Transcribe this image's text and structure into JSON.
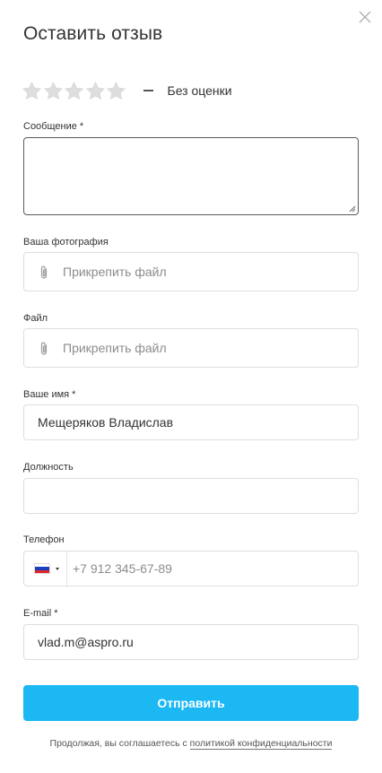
{
  "modal": {
    "title": "Оставить отзыв",
    "close_icon": "close-icon"
  },
  "rating": {
    "stars": 5,
    "selected": 0,
    "dash": "—",
    "text": "Без оценки",
    "star_color": "#dcdcdc"
  },
  "fields": {
    "message": {
      "label": "Сообщение *",
      "value": ""
    },
    "photo": {
      "label": "Ваша фотография",
      "placeholder": "Прикрепить файл",
      "icon": "paperclip-icon"
    },
    "file": {
      "label": "Файл",
      "placeholder": "Прикрепить файл",
      "icon": "paperclip-icon"
    },
    "name": {
      "label": "Ваше имя *",
      "value": "Мещеряков Владислав"
    },
    "position": {
      "label": "Должность",
      "value": ""
    },
    "phone": {
      "label": "Телефон",
      "placeholder": "+7 912 345-67-89",
      "country_flag": "russia-flag-icon"
    },
    "email": {
      "label": "E-mail *",
      "value": "vlad.m@aspro.ru"
    }
  },
  "submit": {
    "label": "Отправить",
    "color": "#1cb8f4"
  },
  "consent": {
    "text": "Продолжая, вы соглашаетесь с ",
    "link": "политикой конфиденциальности"
  }
}
